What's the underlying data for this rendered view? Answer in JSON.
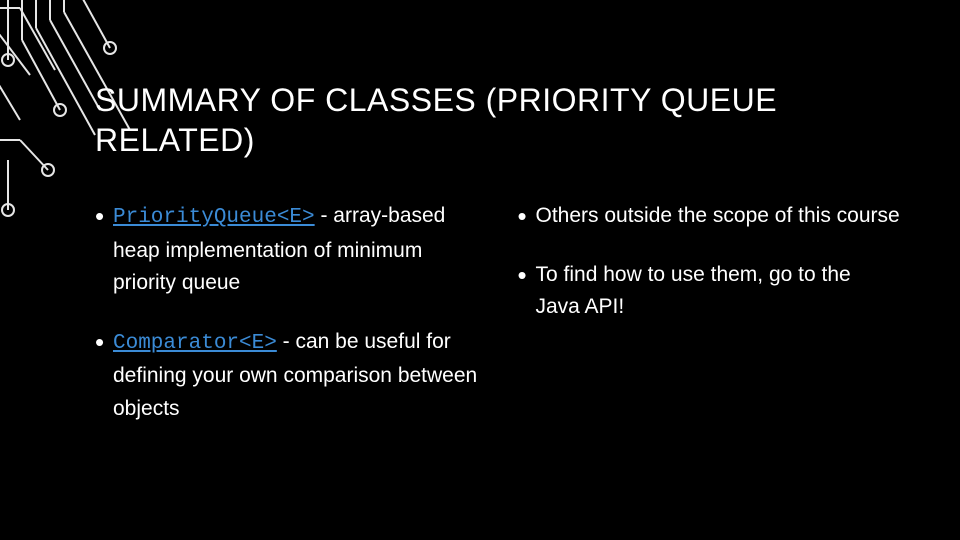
{
  "title": "SUMMARY OF CLASSES (PRIORITY QUEUE RELATED)",
  "left": {
    "item1_code": "PriorityQueue<E>",
    "item1_rest": " - array-based heap implementation of minimum priority queue",
    "item2_code": "Comparator<E>",
    "item2_rest": " - can be useful for defining your own comparison between objects"
  },
  "right": {
    "item1": "Others outside the scope of this course",
    "item2": "To find how to use them, go to the Java API!"
  }
}
